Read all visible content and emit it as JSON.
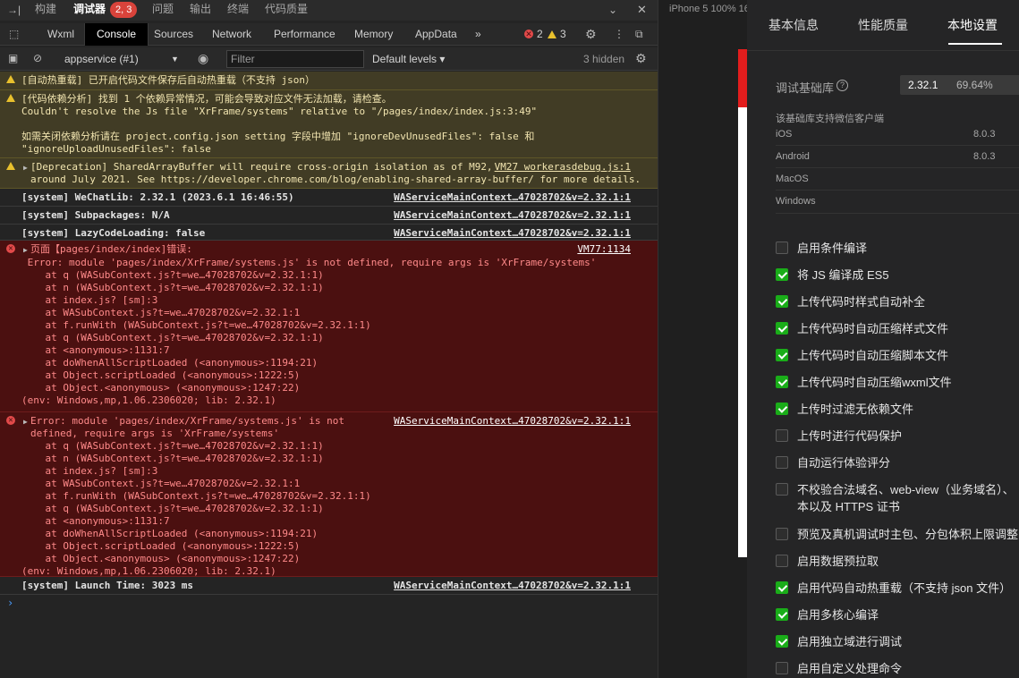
{
  "top_tabs": {
    "build": "构建",
    "debugger": "调试器",
    "badge": "2, 3",
    "issues": "问题",
    "output": "输出",
    "terminal": "终端",
    "code_quality": "代码质量"
  },
  "devtools_tabs": {
    "wxml": "Wxml",
    "console": "Console",
    "sources": "Sources",
    "network": "Network",
    "performance": "Performance",
    "memory": "Memory",
    "appdata": "AppData",
    "more": "»",
    "error_count": "2",
    "warning_count": "3"
  },
  "console_bar": {
    "context": "appservice (#1)",
    "filter_placeholder": "Filter",
    "levels": "Default levels ▾",
    "hidden": "3 hidden"
  },
  "messages": [
    {
      "text": "[自动热重载] 已开启代码文件保存后自动热重载（不支持 json）"
    },
    {
      "text": "[代码依赖分析] 找到 1 个依赖异常情况，可能会导致对应文件无法加载，请检查。\nCouldn't resolve the Js file \"XrFrame/systems\" relative to \"/pages/index/index.js:3:49\"\n\n如需关闭依赖分析请在 project.config.json setting 字段中增加 \"ignoreDevUnusedFiles\": false 和\n\"ignoreUploadUnusedFiles\": false"
    },
    {
      "text": "[Deprecation] SharedArrayBuffer will require cross-origin isolation as of M92,\naround July 2021. See https://developer.chrome.com/blog/enabling-shared-array-buffer/ for more details.",
      "source": "VM27 workerasdebug.js:1"
    },
    {
      "text": "[system] WeChatLib: 2.32.1 (2023.6.1 16:46:55)",
      "source": "WAServiceMainContext…47028702&v=2.32.1:1"
    },
    {
      "text": "[system] Subpackages: N/A",
      "source": "WAServiceMainContext…47028702&v=2.32.1:1"
    },
    {
      "text": "[system] LazyCodeLoading: false",
      "source": "WAServiceMainContext…47028702&v=2.32.1:1"
    },
    {
      "text": "页面【pages/index/index]错误:",
      "source": "VM77:1134",
      "stack": " Error: module 'pages/index/XrFrame/systems.js' is not defined, require args is 'XrFrame/systems'\n    at q (WASubContext.js?t=we…47028702&v=2.32.1:1)\n    at n (WASubContext.js?t=we…47028702&v=2.32.1:1)\n    at index.js? [sm]:3\n    at WASubContext.js?t=we…47028702&v=2.32.1:1\n    at f.runWith (WASubContext.js?t=we…47028702&v=2.32.1:1)\n    at q (WASubContext.js?t=we…47028702&v=2.32.1:1)\n    at <anonymous>:1131:7\n    at doWhenAllScriptLoaded (<anonymous>:1194:21)\n    at Object.scriptLoaded (<anonymous>:1222:5)\n    at Object.<anonymous> (<anonymous>:1247:22)\n(env: Windows,mp,1.06.2306020; lib: 2.32.1)"
    },
    {
      "text": "Error: module 'pages/index/XrFrame/systems.js' is not\ndefined, require args is 'XrFrame/systems'",
      "source": "WAServiceMainContext…47028702&v=2.32.1:1",
      "stack": "    at q (WASubContext.js?t=we…47028702&v=2.32.1:1)\n    at n (WASubContext.js?t=we…47028702&v=2.32.1:1)\n    at index.js? [sm]:3\n    at WASubContext.js?t=we…47028702&v=2.32.1:1\n    at f.runWith (WASubContext.js?t=we…47028702&v=2.32.1:1)\n    at q (WASubContext.js?t=we…47028702&v=2.32.1:1)\n    at <anonymous>:1131:7\n    at doWhenAllScriptLoaded (<anonymous>:1194:21)\n    at Object.scriptLoaded (<anonymous>:1222:5)\n    at Object.<anonymous> (<anonymous>:1247:22)\n(env: Windows,mp,1.06.2306020; lib: 2.32.1)"
    },
    {
      "text": "[system] Launch Time: 3023 ms",
      "source": "WAServiceMainContext…47028702&v=2.32.1:1"
    }
  ],
  "prompt": "›",
  "simulator": {
    "label": "iPhone 5 100% 16"
  },
  "settings": {
    "tabs": [
      "基本信息",
      "性能质量",
      "本地设置"
    ],
    "lib_label": "调试基础库",
    "lib_version": "2.32.1",
    "lib_percent": "69.64%",
    "support_title": "该基础库支持微信客户端",
    "platforms": [
      {
        "name": "iOS",
        "version": "8.0.3"
      },
      {
        "name": "Android",
        "version": "8.0.3"
      },
      {
        "name": "MacOS",
        "version": ""
      },
      {
        "name": "Windows",
        "version": ""
      }
    ],
    "options": [
      {
        "label": "启用条件编译",
        "checked": false
      },
      {
        "label": "将 JS 编译成 ES5",
        "checked": true
      },
      {
        "label": "上传代码时样式自动补全",
        "checked": true
      },
      {
        "label": "上传代码时自动压缩样式文件",
        "checked": true
      },
      {
        "label": "上传代码时自动压缩脚本文件",
        "checked": true
      },
      {
        "label": "上传代码时自动压缩wxml文件",
        "checked": true
      },
      {
        "label": "上传时过滤无依赖文件",
        "checked": true
      },
      {
        "label": "上传时进行代码保护",
        "checked": false
      },
      {
        "label": "自动运行体验评分",
        "checked": false
      },
      {
        "label": "不校验合法域名、web-view（业务域名）、",
        "label2": "本以及 HTTPS 证书",
        "checked": false
      },
      {
        "label": "预览及真机调试时主包、分包体积上限调整",
        "checked": false
      },
      {
        "label": "启用数据预拉取",
        "checked": false
      },
      {
        "label": "启用代码自动热重载（不支持 json 文件）",
        "checked": true
      },
      {
        "label": "启用多核心编译",
        "checked": true
      },
      {
        "label": "启用独立域进行调试",
        "checked": true
      },
      {
        "label": "启用自定义处理命令",
        "checked": false
      }
    ]
  }
}
